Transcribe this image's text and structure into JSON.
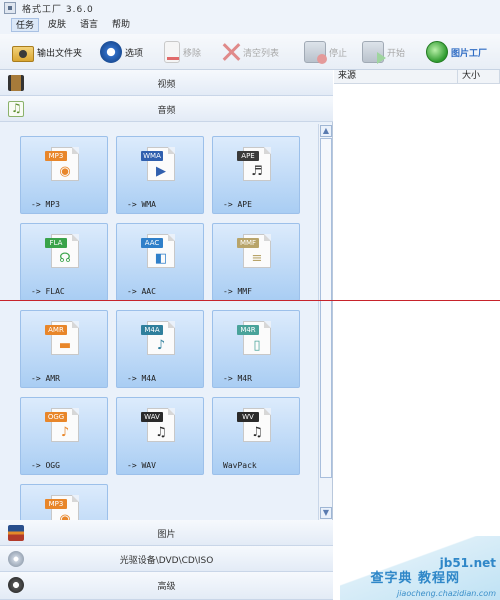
{
  "window": {
    "title": "格式工厂 3.6.0"
  },
  "menu": [
    "任务",
    "皮肤",
    "语言",
    "帮助"
  ],
  "toolbar": {
    "output_folder": "输出文件夹",
    "options": "选项",
    "remove": "移除",
    "clear_list": "清空列表",
    "stop": "停止",
    "start": "开始",
    "brand": "图片工厂"
  },
  "categories": {
    "video": "视频",
    "audio": "音频",
    "image": "图片",
    "disc": "光驱设备\\DVD\\CD\\ISO",
    "advanced": "高级"
  },
  "audio_formats": [
    {
      "badge": "MP3",
      "label": "-> MP3",
      "badge_color": "#e8862a",
      "icon": "speaker-icon"
    },
    {
      "badge": "WMA",
      "label": "-> WMA",
      "badge_color": "#2f5fae",
      "icon": "play-disc-icon"
    },
    {
      "badge": "APE",
      "label": "-> APE",
      "badge_color": "#3a3a3a",
      "icon": "headphones-icon"
    },
    {
      "badge": "FLA",
      "label": "-> FLAC",
      "badge_color": "#3aa34a",
      "icon": "headset-icon"
    },
    {
      "badge": "AAC",
      "label": "-> AAC",
      "badge_color": "#2f7fc9",
      "icon": "speaker-box-icon"
    },
    {
      "badge": "MMF",
      "label": "-> MMF",
      "badge_color": "#b8a46a",
      "icon": "document-icon"
    },
    {
      "badge": "AMR",
      "label": "-> AMR",
      "badge_color": "#e8862a",
      "icon": "device-icon"
    },
    {
      "badge": "M4A",
      "label": "-> M4A",
      "badge_color": "#2f7f9c",
      "icon": "disc-note-icon"
    },
    {
      "badge": "M4R",
      "label": "-> M4R",
      "badge_color": "#4aa39a",
      "icon": "phone-icon"
    },
    {
      "badge": "OGG",
      "label": "-> OGG",
      "badge_color": "#e8862a",
      "icon": "music-note-icon"
    },
    {
      "badge": "WAV",
      "label": "-> WAV",
      "badge_color": "#2a2a2a",
      "icon": "notes-icon"
    },
    {
      "badge": "WV",
      "label": "WavPack",
      "badge_color": "#2a2a2a",
      "icon": "green-note-icon"
    },
    {
      "badge": "MP3",
      "label": "",
      "badge_color": "#e8862a",
      "icon": "speaker-icon"
    }
  ],
  "list_columns": [
    "来源",
    "大小"
  ],
  "watermark": {
    "site": "jb51.net",
    "text": "查字典 教程网",
    "url": "jiaocheng.chazidian.com"
  }
}
